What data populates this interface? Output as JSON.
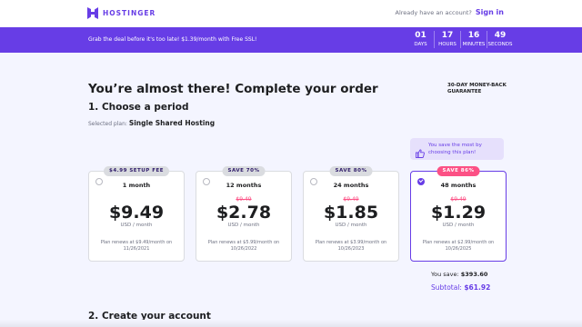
{
  "header": {
    "brand": "HOSTINGER",
    "account_text": "Already have an account?",
    "signin_label": "Sign in"
  },
  "promo": {
    "text": "Grab the deal before it's too late! $1.39/month with Free SSL!",
    "countdown": [
      {
        "value": "01",
        "label": "DAYS"
      },
      {
        "value": "17",
        "label": "HOURS"
      },
      {
        "value": "16",
        "label": "MINUTES"
      },
      {
        "value": "49",
        "label": "SECONDS"
      }
    ]
  },
  "page": {
    "title": "You’re almost there! Complete your order",
    "guarantee": "30-DAY MONEY-BACK GUARANTEE",
    "step1_title": "1. Choose a period",
    "selected_plan_label": "Selected plan:",
    "selected_plan_value": "Single Shared Hosting",
    "tip": "You save the most by choosing this plan!",
    "step2_title": "2. Create your account"
  },
  "plans": [
    {
      "badge": "$4.99 SETUP FEE",
      "period": "1 month",
      "old_price": "",
      "price": "$9.49",
      "unit": "USD / month",
      "renew": "Plan renews at $9.49/month on 11/26/2021",
      "selected": false
    },
    {
      "badge": "SAVE 70%",
      "period": "12 months",
      "old_price": "$9.49",
      "price": "$2.78",
      "unit": "USD / month",
      "renew": "Plan renews at $5.99/month on 10/26/2022",
      "selected": false
    },
    {
      "badge": "SAVE 80%",
      "period": "24 months",
      "old_price": "$9.49",
      "price": "$1.85",
      "unit": "USD / month",
      "renew": "Plan renews at $3.99/month on 10/26/2023",
      "selected": false
    },
    {
      "badge": "SAVE 86%",
      "period": "48 months",
      "old_price": "$9.49",
      "price": "$1.29",
      "unit": "USD / month",
      "renew": "Plan renews at $2.99/month on 10/26/2025",
      "selected": true
    }
  ],
  "summary": {
    "save_label": "You save:",
    "save_value": "$393.60",
    "subtotal_label": "Subtotal:",
    "subtotal_value": "$61.92"
  },
  "colors": {
    "brand": "#673de6",
    "hot_badge": "#fc5185",
    "strike": "#fc5185"
  }
}
